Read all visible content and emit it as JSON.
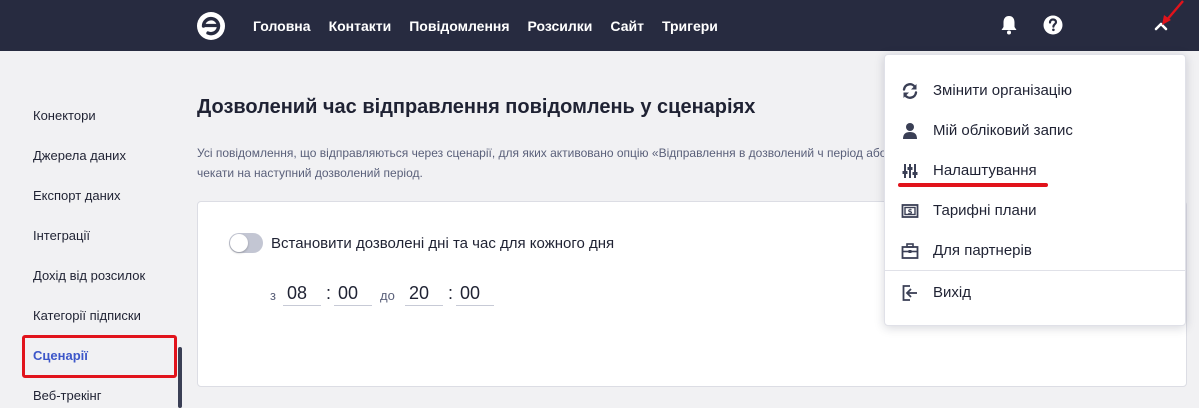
{
  "nav": {
    "items": [
      {
        "label": "Головна"
      },
      {
        "label": "Контакти"
      },
      {
        "label": "Повідомлення"
      },
      {
        "label": "Розсилки"
      },
      {
        "label": "Сайт"
      },
      {
        "label": "Тригери"
      }
    ],
    "icons": [
      "logo-icon",
      "bell-icon",
      "help-icon",
      "chevron-up-icon"
    ]
  },
  "sidebar": {
    "items": [
      {
        "label": "Конектори"
      },
      {
        "label": "Джерела даних"
      },
      {
        "label": "Експорт даних"
      },
      {
        "label": "Інтеграції"
      },
      {
        "label": "Дохід від розсилок"
      },
      {
        "label": "Категорії підписки"
      },
      {
        "label": "Сценарії",
        "active": true
      },
      {
        "label": "Веб-трекінг"
      }
    ]
  },
  "main": {
    "title": "Дозволений час відправлення повідомлень у сценаріях",
    "description": "Усі повідомлення, що відправляються через сценарії, для яких активовано опцію «Відправлення в дозволений ч період або чекати на наступний дозволений період.",
    "toggle_label": "Встановити дозволені дні та час для кожного дня",
    "toggle_on": false,
    "time": {
      "from_label": "з",
      "from_hours": "08",
      "from_minutes": "00",
      "to_label": "до",
      "to_hours": "20",
      "to_minutes": "00",
      "separator": ":"
    }
  },
  "dropdown": {
    "items": [
      {
        "label": "Змінити організацію",
        "icon": "refresh-icon"
      },
      {
        "label": "Мій обліковий запис",
        "icon": "user-icon"
      },
      {
        "label": "Налаштування",
        "icon": "sliders-icon"
      },
      {
        "label": "Тарифні плани",
        "icon": "money-icon"
      },
      {
        "label": "Для партнерів",
        "icon": "briefcase-icon"
      },
      {
        "label": "Вихід",
        "icon": "logout-icon"
      }
    ]
  },
  "colors": {
    "topbar": "#272b40",
    "accent": "#3d57c9",
    "annotation": "#e1131b"
  }
}
